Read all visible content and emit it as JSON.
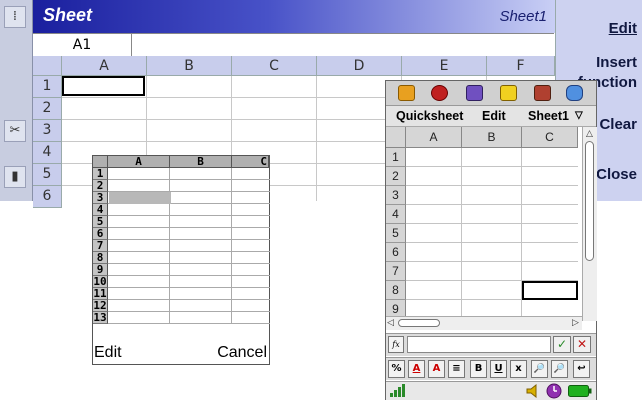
{
  "panel1": {
    "title": "Sheet",
    "sheet_name": "Sheet1",
    "cell_ref": "A1",
    "columns": [
      "A",
      "B",
      "C",
      "D",
      "E",
      "F"
    ],
    "rows": [
      "1",
      "2",
      "3",
      "4",
      "5",
      "6"
    ],
    "side_icons": [
      "zoom-icon",
      "cut-icon",
      "battery-icon"
    ],
    "menu": {
      "edit": "Edit",
      "insert_function_1": "Insert",
      "insert_function_2": "function",
      "clear": "Clear",
      "close": "Close"
    }
  },
  "panel2": {
    "columns": [
      "A",
      "B",
      "C"
    ],
    "rows": [
      "1",
      "2",
      "3",
      "4",
      "5",
      "6",
      "7",
      "8",
      "9",
      "10",
      "11",
      "12",
      "13"
    ],
    "softkey_left": "Edit",
    "softkey_right": "Cancel"
  },
  "panel3": {
    "app_icons": [
      "mail-icon",
      "globe-icon",
      "book-icon",
      "tasks-icon",
      "toolbox-icon",
      "apps-icon"
    ],
    "menu_app": "Quicksheet",
    "menu_edit": "Edit",
    "menu_sheet": "Sheet1",
    "columns": [
      "A",
      "B",
      "C"
    ],
    "rows": [
      "1",
      "2",
      "3",
      "4",
      "5",
      "6",
      "7",
      "8",
      "9"
    ],
    "fx_label": "fx",
    "toolbar": [
      "%",
      "A",
      "A",
      "≡",
      "B",
      "U",
      "ⅹ",
      "🔎",
      "🔎",
      "↩"
    ]
  }
}
